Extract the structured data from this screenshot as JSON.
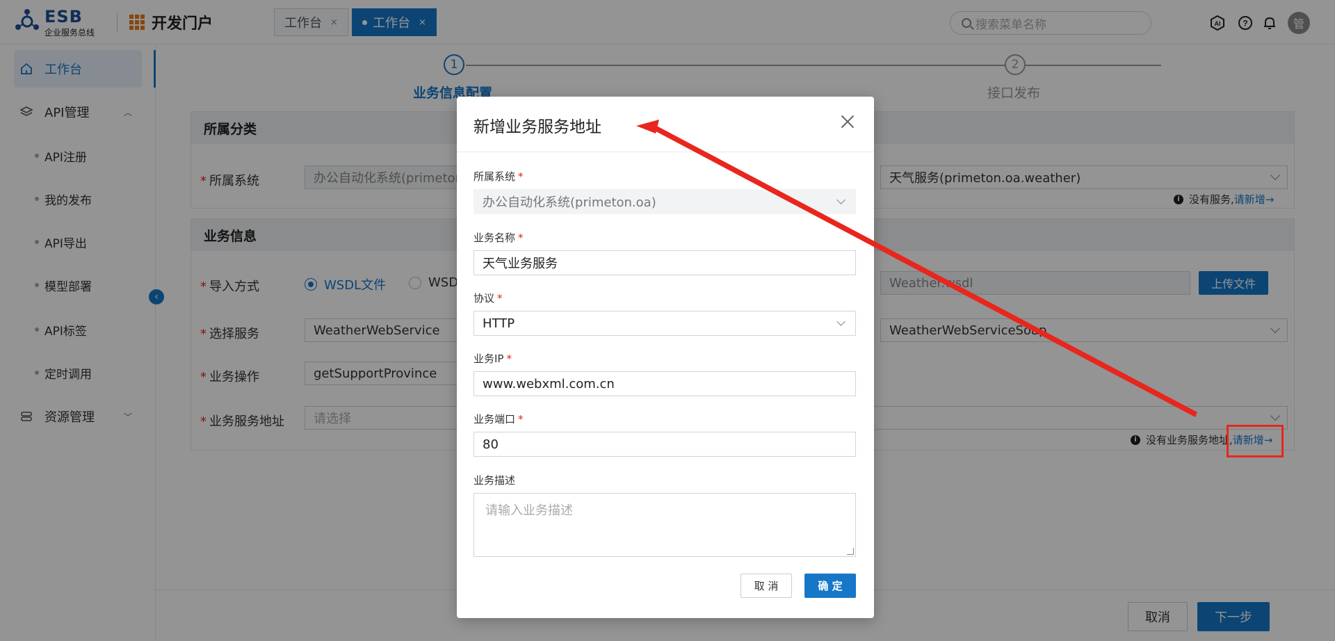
{
  "header": {
    "logo_text": "ESB",
    "logo_subtitle": "企业服务总线",
    "portal_title": "开发门户",
    "tabs": [
      {
        "label": "工作台",
        "close": "×"
      },
      {
        "label": "工作台",
        "close": "×"
      }
    ],
    "search_placeholder": "搜索菜单名称",
    "avatar_text": "管"
  },
  "sidebar": {
    "items": [
      {
        "label": "工作台"
      },
      {
        "label": "API管理"
      },
      {
        "label": "资源管理"
      }
    ],
    "sub_items": [
      {
        "label": "API注册"
      },
      {
        "label": "我的发布"
      },
      {
        "label": "API导出"
      },
      {
        "label": "模型部署"
      },
      {
        "label": "API标签"
      },
      {
        "label": "定时调用"
      }
    ],
    "collapse_icon": "‹"
  },
  "steps": [
    {
      "num": "1",
      "label": "业务信息配置"
    },
    {
      "num": "2",
      "label": "接口发布"
    }
  ],
  "form": {
    "section1_title": "所属分类",
    "system_label": "所属系统",
    "system_value": "办公自动化系统(primeton.oa)",
    "service_value": "天气服务(primeton.oa.weather)",
    "hint1_text": "没有服务,",
    "hint1_link": "请新增→",
    "section2_title": "业务信息",
    "import_label": "导入方式",
    "radio_wsdl_file": "WSDL文件",
    "radio_wsdl_url": "WSDL",
    "file_value": "Weather.wsdl",
    "upload_button": "上传文件",
    "select_service_label": "选择服务",
    "select_service_value": "WeatherWebService",
    "port_value": "WeatherWebServiceSoap",
    "operation_label": "业务操作",
    "operation_value": "getSupportProvince",
    "address_label": "业务服务地址",
    "address_placeholder": "请选择",
    "hint2_text": "没有业务服务地址,",
    "hint2_link": "请新增→"
  },
  "footer": {
    "cancel": "取消",
    "next": "下一步"
  },
  "modal": {
    "title": "新增业务服务地址",
    "fields": {
      "system_label": "所属系统",
      "system_value": "办公自动化系统(primeton.oa)",
      "name_label": "业务名称",
      "name_value": "天气业务服务",
      "protocol_label": "协议",
      "protocol_value": "HTTP",
      "ip_label": "业务IP",
      "ip_value": "www.webxml.com.cn",
      "port_label": "业务端口",
      "port_value": "80",
      "desc_label": "业务描述",
      "desc_placeholder": "请输入业务描述"
    },
    "cancel": "取 消",
    "confirm": "确 定",
    "required_mark": "*"
  },
  "colors": {
    "primary": "#1677c9",
    "required": "#e02020",
    "annotation": "#e8261d"
  }
}
